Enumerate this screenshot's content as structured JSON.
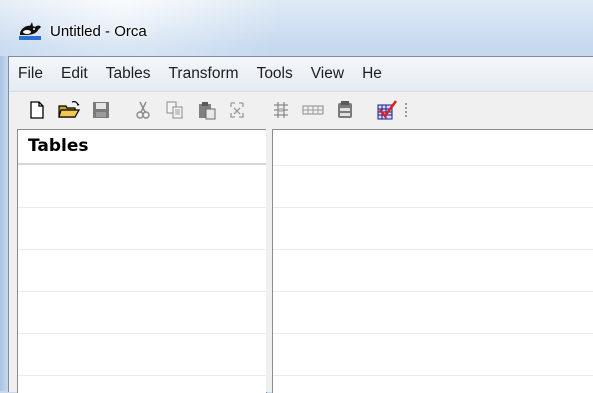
{
  "window": {
    "title": "Untitled - Orca",
    "icon": "orca-whale-icon"
  },
  "menubar": {
    "items": [
      "File",
      "Edit",
      "Tables",
      "Transform",
      "Tools",
      "View",
      "He"
    ]
  },
  "toolbar": {
    "buttons": [
      {
        "name": "new-icon"
      },
      {
        "name": "open-folder-icon"
      },
      {
        "name": "save-icon"
      },
      {
        "name": "cut-icon"
      },
      {
        "name": "copy-icon"
      },
      {
        "name": "paste-icon"
      },
      {
        "name": "find-icon"
      },
      {
        "name": "add-table-icon"
      },
      {
        "name": "add-row-icon"
      },
      {
        "name": "paste-row-icon"
      },
      {
        "name": "validate-icon"
      }
    ]
  },
  "tables_pane": {
    "header": "Tables"
  },
  "colors": {
    "validate_check": "#e02020",
    "folder": "#f2c94c"
  }
}
